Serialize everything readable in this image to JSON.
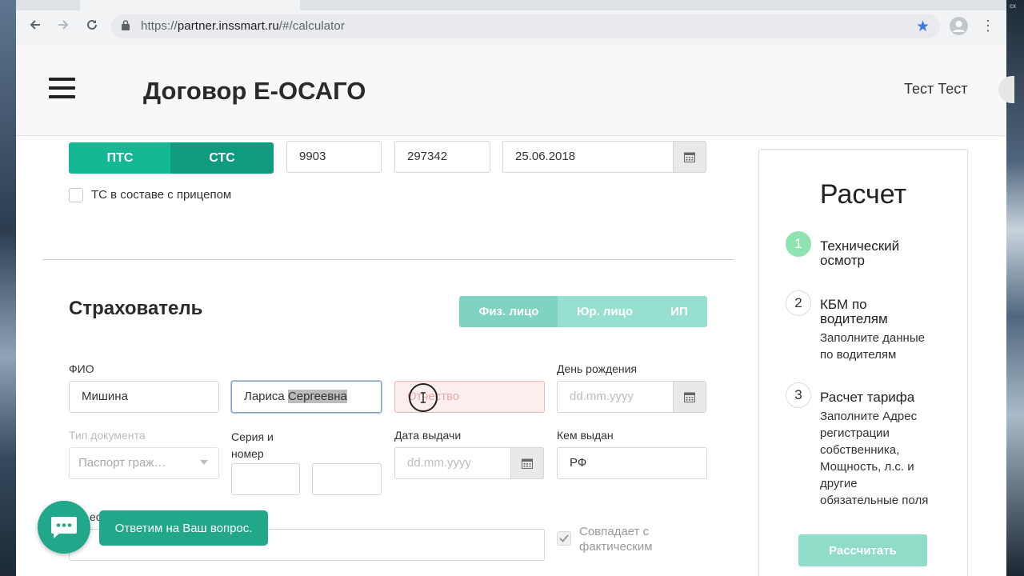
{
  "browser": {
    "url_prefix": "https://",
    "url_domain": "partner.inssmart.ru",
    "url_path": "/#/calculator",
    "corner_text": "сх"
  },
  "header": {
    "title": "Договор Е-ОСАГО",
    "user_name": "Тест Тест"
  },
  "vehicle_doc": {
    "doc_types": [
      "ПТС",
      "СТС"
    ],
    "series": "9903",
    "number": "297342",
    "issue_date": "25.06.2018",
    "trailer_label": "ТС в составе с прицепом"
  },
  "insurer": {
    "section_title": "Страхователь",
    "person_types": [
      "Физ. лицо",
      "Юр. лицо",
      "ИП"
    ],
    "fio_label": "ФИО",
    "last_name": "Мишина",
    "first_name": "Лариса",
    "middle_name_selected": "Сергеевна",
    "patronymic_placeholder": "Отчество",
    "birthday_label": "День рождения",
    "date_placeholder": "dd.mm.yyyy",
    "doc_type_label": "Тип документа",
    "doc_type_value": "Паспорт граж…",
    "series_number_label_1": "Серия и",
    "series_number_label_2": "номер",
    "issue_date_label": "Дата выдачи",
    "issued_by_label": "Кем выдан",
    "issued_by_value": "РФ",
    "address_label_partial": "ес",
    "same_as_actual_1": "Совпадает с",
    "same_as_actual_2": "фактическим"
  },
  "sidebar": {
    "title": "Расчет",
    "steps": [
      {
        "num": "1",
        "title_1": "Технический",
        "title_2": "осмотр",
        "desc": []
      },
      {
        "num": "2",
        "title_1": "КБМ по",
        "title_2": "водителям",
        "desc": [
          "Заполните данные",
          "по водителям"
        ]
      },
      {
        "num": "3",
        "title_1": "Расчет тарифа",
        "title_2": "",
        "desc": [
          "Заполните Адрес",
          "регистрации",
          "собственника,",
          "Мощность, л.с. и",
          "другие",
          "обязательные поля"
        ]
      }
    ],
    "calc_button": "Рассчитать"
  },
  "chat": {
    "tooltip": "Ответим на Ваш вопрос."
  },
  "colors": {
    "accent": "#14b894",
    "accent_dark": "#0f9c7e",
    "accent_light": "#97dfcf",
    "accent_active": "#7fd3c1",
    "step_done": "#8ee4b0",
    "error_bg": "#fdeeee",
    "error_border": "#f0b7b7"
  }
}
